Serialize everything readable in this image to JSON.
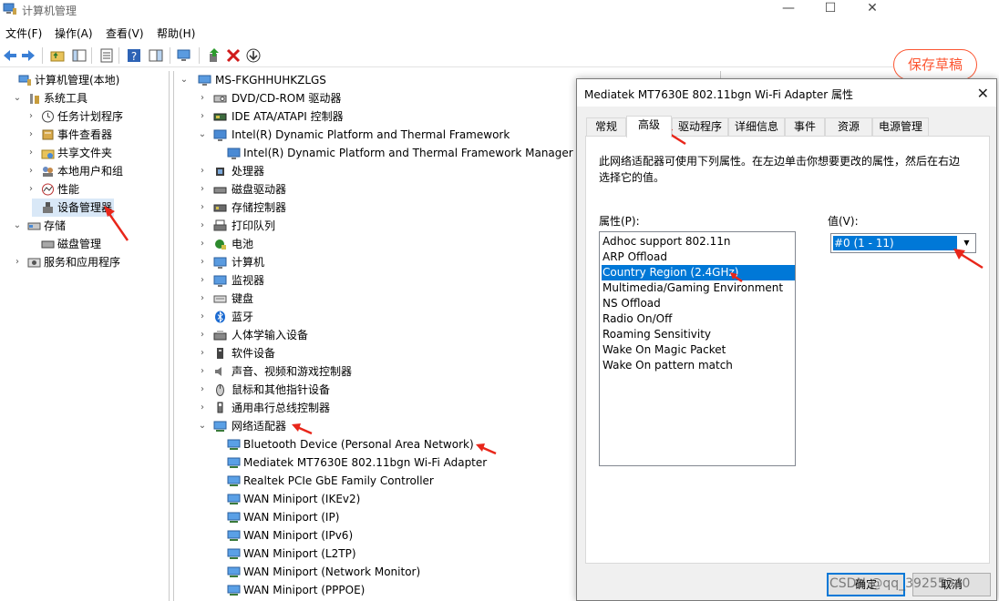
{
  "window": {
    "title": "计算机管理",
    "menu": [
      "文件(F)",
      "操作(A)",
      "查看(V)",
      "帮助(H)"
    ]
  },
  "left_tree": [
    {
      "label": "计算机管理(本地)",
      "indent": 0,
      "exp": "",
      "icon": "computer-management-icon"
    },
    {
      "label": "系统工具",
      "indent": 1,
      "exp": "⌄",
      "icon": "tools-icon"
    },
    {
      "label": "任务计划程序",
      "indent": 2,
      "exp": "›",
      "icon": "clock-icon"
    },
    {
      "label": "事件查看器",
      "indent": 2,
      "exp": "›",
      "icon": "event-viewer-icon"
    },
    {
      "label": "共享文件夹",
      "indent": 2,
      "exp": "›",
      "icon": "shared-folder-icon"
    },
    {
      "label": "本地用户和组",
      "indent": 2,
      "exp": "›",
      "icon": "users-icon"
    },
    {
      "label": "性能",
      "indent": 2,
      "exp": "›",
      "icon": "performance-icon"
    },
    {
      "label": "设备管理器",
      "indent": 2,
      "exp": "",
      "icon": "device-manager-icon",
      "selected": true
    },
    {
      "label": "存储",
      "indent": 1,
      "exp": "⌄",
      "icon": "storage-icon"
    },
    {
      "label": "磁盘管理",
      "indent": 2,
      "exp": "",
      "icon": "disk-icon"
    },
    {
      "label": "服务和应用程序",
      "indent": 1,
      "exp": "›",
      "icon": "services-icon"
    }
  ],
  "device_tree": {
    "root": "MS-FKGHHUHKZLGS",
    "rows": [
      {
        "label": "DVD/CD-ROM 驱动器",
        "indent": 1,
        "exp": "›",
        "icon": "dvd-icon"
      },
      {
        "label": "IDE ATA/ATAPI 控制器",
        "indent": 1,
        "exp": "›",
        "icon": "ide-icon"
      },
      {
        "label": "Intel(R) Dynamic Platform and Thermal Framework",
        "indent": 1,
        "exp": "⌄",
        "icon": "intel-icon"
      },
      {
        "label": "Intel(R) Dynamic Platform and Thermal Framework Manager",
        "indent": 2,
        "exp": "",
        "icon": "intel-icon"
      },
      {
        "label": "处理器",
        "indent": 1,
        "exp": "›",
        "icon": "processor-icon"
      },
      {
        "label": "磁盘驱动器",
        "indent": 1,
        "exp": "›",
        "icon": "disk-drive-icon"
      },
      {
        "label": "存储控制器",
        "indent": 1,
        "exp": "›",
        "icon": "storage-controller-icon"
      },
      {
        "label": "打印队列",
        "indent": 1,
        "exp": "›",
        "icon": "printer-icon"
      },
      {
        "label": "电池",
        "indent": 1,
        "exp": "›",
        "icon": "battery-icon"
      },
      {
        "label": "计算机",
        "indent": 1,
        "exp": "›",
        "icon": "monitor-icon"
      },
      {
        "label": "监视器",
        "indent": 1,
        "exp": "›",
        "icon": "monitor-icon"
      },
      {
        "label": "键盘",
        "indent": 1,
        "exp": "›",
        "icon": "keyboard-icon"
      },
      {
        "label": "蓝牙",
        "indent": 1,
        "exp": "›",
        "icon": "bluetooth-icon"
      },
      {
        "label": "人体学输入设备",
        "indent": 1,
        "exp": "›",
        "icon": "hid-icon"
      },
      {
        "label": "软件设备",
        "indent": 1,
        "exp": "›",
        "icon": "software-device-icon"
      },
      {
        "label": "声音、视频和游戏控制器",
        "indent": 1,
        "exp": "›",
        "icon": "speaker-icon"
      },
      {
        "label": "鼠标和其他指针设备",
        "indent": 1,
        "exp": "›",
        "icon": "mouse-icon"
      },
      {
        "label": "通用串行总线控制器",
        "indent": 1,
        "exp": "›",
        "icon": "usb-icon"
      },
      {
        "label": "网络适配器",
        "indent": 1,
        "exp": "⌄",
        "icon": "network-adapter-icon"
      },
      {
        "label": "Bluetooth Device (Personal Area Network)",
        "indent": 2,
        "exp": "",
        "icon": "network-adapter-icon"
      },
      {
        "label": "Mediatek MT7630E 802.11bgn Wi-Fi Adapter",
        "indent": 2,
        "exp": "",
        "icon": "network-adapter-icon"
      },
      {
        "label": "Realtek PCIe GbE Family Controller",
        "indent": 2,
        "exp": "",
        "icon": "network-adapter-icon"
      },
      {
        "label": "WAN Miniport (IKEv2)",
        "indent": 2,
        "exp": "",
        "icon": "network-adapter-icon"
      },
      {
        "label": "WAN Miniport (IP)",
        "indent": 2,
        "exp": "",
        "icon": "network-adapter-icon"
      },
      {
        "label": "WAN Miniport (IPv6)",
        "indent": 2,
        "exp": "",
        "icon": "network-adapter-icon"
      },
      {
        "label": "WAN Miniport (L2TP)",
        "indent": 2,
        "exp": "",
        "icon": "network-adapter-icon"
      },
      {
        "label": "WAN Miniport (Network Monitor)",
        "indent": 2,
        "exp": "",
        "icon": "network-adapter-icon"
      },
      {
        "label": "WAN Miniport (PPPOE)",
        "indent": 2,
        "exp": "",
        "icon": "network-adapter-icon"
      }
    ]
  },
  "background": {
    "save_draft": "保存草稿"
  },
  "dialog": {
    "title": "Mediatek MT7630E 802.11bgn Wi-Fi Adapter 属性",
    "tabs": [
      "常规",
      "高级",
      "驱动程序",
      "详细信息",
      "事件",
      "资源",
      "电源管理"
    ],
    "active_tab": "高级",
    "description": "此网络适配器可使用下列属性。在左边单击你想要更改的属性，然后在右边选择它的值。",
    "property_label": "属性(P):",
    "value_label": "值(V):",
    "properties": [
      "Adhoc support 802.11n",
      "ARP Offload",
      "Country Region (2.4GHz)",
      "Multimedia/Gaming Environment",
      "NS Offload",
      "Radio On/Off",
      "Roaming Sensitivity",
      "Wake On Magic Packet",
      "Wake On pattern match"
    ],
    "selected_property": "Country Region (2.4GHz)",
    "value": "#0 (1 - 11)",
    "ok_label": "确定",
    "cancel_label": "取消"
  },
  "watermark": "CSDN @qq_39255340",
  "colors": {
    "selection": "#0078d7",
    "annotation_arrow": "#e8261a",
    "save_draft": "#fc5531"
  }
}
